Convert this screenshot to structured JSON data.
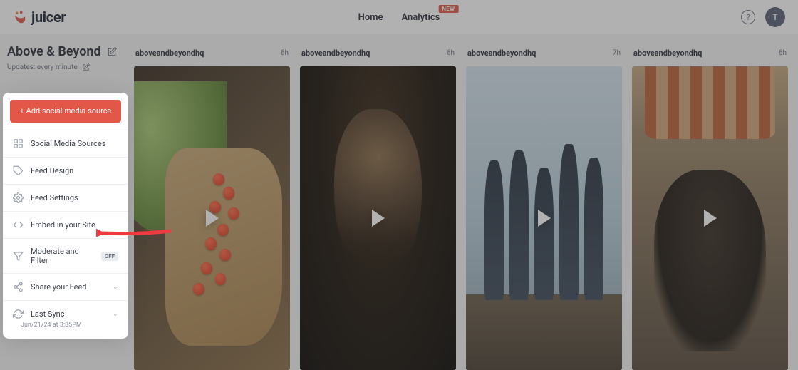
{
  "header": {
    "logo_text": "juicer",
    "nav": {
      "home": "Home",
      "analytics": "Analytics",
      "new_badge": "NEW"
    },
    "avatar_initial": "T"
  },
  "sidebar": {
    "feed_title": "Above & Beyond",
    "updates_label": "Updates: every minute",
    "add_source_label": "+ Add social media source",
    "items": {
      "sources": "Social Media Sources",
      "design": "Feed Design",
      "settings": "Feed Settings",
      "embed": "Embed in your Site",
      "moderate": "Moderate and Filter",
      "moderate_badge": "OFF",
      "share": "Share your Feed",
      "sync": "Last Sync",
      "sync_time": "Jun/21/24 at 3:35PM"
    }
  },
  "posts": [
    {
      "username": "aboveandbeyondhq",
      "time": "6h"
    },
    {
      "username": "aboveandbeyondhq",
      "time": "6h"
    },
    {
      "username": "aboveandbeyondhq",
      "time": "7h"
    },
    {
      "username": "aboveandbeyondhq",
      "time": "6h"
    }
  ]
}
